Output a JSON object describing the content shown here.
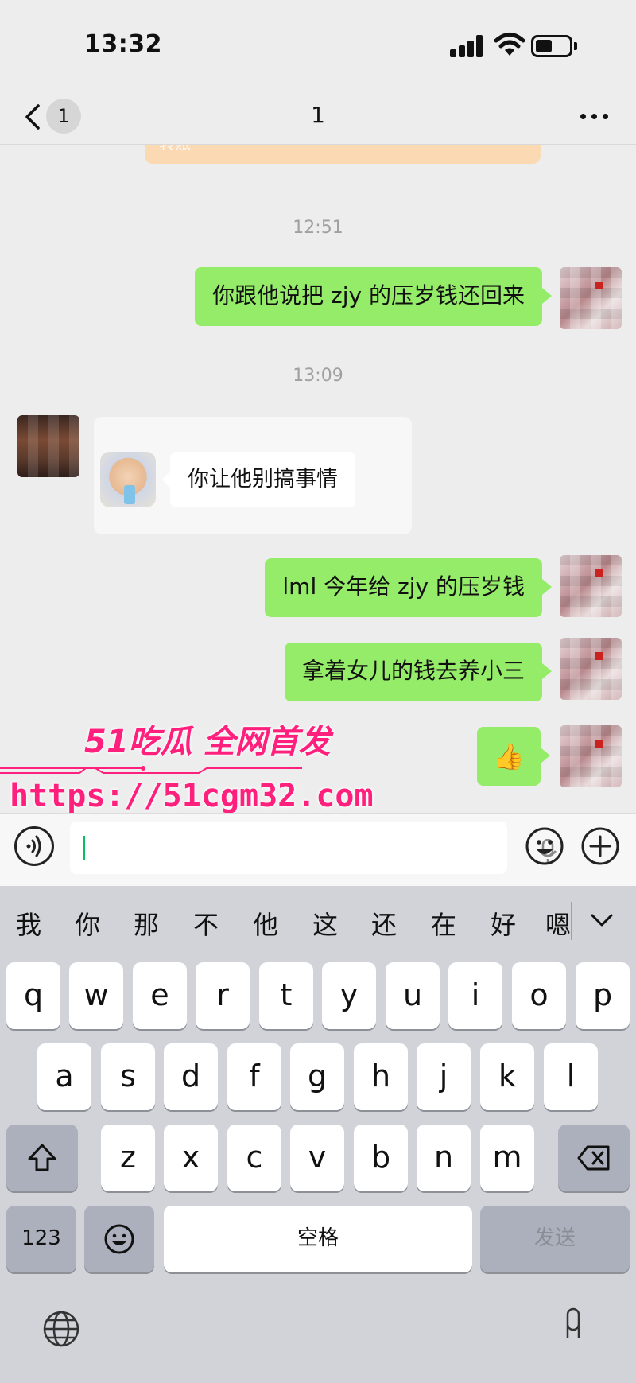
{
  "status_bar": {
    "time": "13:32"
  },
  "nav": {
    "unread_count": "1",
    "title": "1"
  },
  "chat": {
    "transfer_label": "转账",
    "messages": [
      {
        "type": "time",
        "text": "12:51"
      },
      {
        "type": "sent",
        "text": "你跟他说把 zjy 的压岁钱还回来"
      },
      {
        "type": "time",
        "text": "13:09"
      },
      {
        "type": "received",
        "text": "你让他别搞事情"
      },
      {
        "type": "sent",
        "text": "lml 今年给 zjy 的压岁钱"
      },
      {
        "type": "sent",
        "text": "拿着女儿的钱去养小三"
      },
      {
        "type": "sent",
        "text": "👍"
      }
    ]
  },
  "watermark": {
    "tagline": "51吃瓜 全网首发",
    "url": "https://51cgm32.com"
  },
  "input": {
    "value": ""
  },
  "keyboard": {
    "candidates": [
      "我",
      "你",
      "那",
      "不",
      "他",
      "这",
      "还",
      "在",
      "好",
      "嗯"
    ],
    "row1": [
      "q",
      "w",
      "e",
      "r",
      "t",
      "y",
      "u",
      "i",
      "o",
      "p"
    ],
    "row2": [
      "a",
      "s",
      "d",
      "f",
      "g",
      "h",
      "j",
      "k",
      "l"
    ],
    "row3": [
      "z",
      "x",
      "c",
      "v",
      "b",
      "n",
      "m"
    ],
    "numbers_label": "123",
    "space_label": "空格",
    "send_label": "发送"
  },
  "colors": {
    "sent_bubble": "#95ec69",
    "accent": "#07c160",
    "watermark": "#ff1f7c"
  }
}
